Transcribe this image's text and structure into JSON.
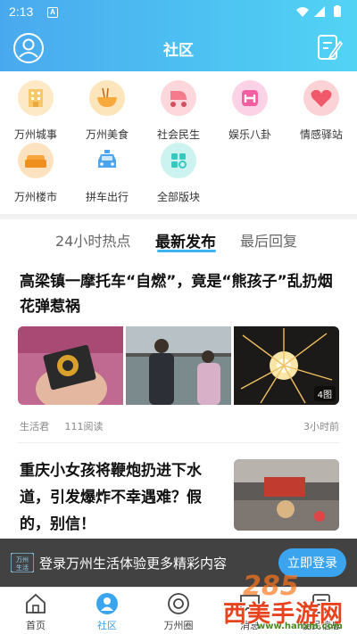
{
  "status_bar": {
    "time": "2:13",
    "notification": "A"
  },
  "header": {
    "title": "社区"
  },
  "categories": [
    {
      "label": "万州城事",
      "icon": "city-building-icon",
      "color": "#f6c86a"
    },
    {
      "label": "万州美食",
      "icon": "noodle-bowl-icon",
      "color": "#f8c14f"
    },
    {
      "label": "社会民生",
      "icon": "baby-stroller-icon",
      "color": "#f57a8c"
    },
    {
      "label": "娱乐八卦",
      "icon": "entertainment-icon",
      "color": "#f35ea2"
    },
    {
      "label": "情感驿站",
      "icon": "heart-icon",
      "color": "#f0596a"
    },
    {
      "label": "万州楼市",
      "icon": "sofa-icon",
      "color": "#f7a53a"
    },
    {
      "label": "拼车出行",
      "icon": "taxi-icon",
      "color": "#4aa4ee"
    },
    {
      "label": "全部版块",
      "icon": "all-sections-icon",
      "color": "#37c9c0"
    }
  ],
  "tabs": [
    {
      "label": "24小时热点",
      "active": false
    },
    {
      "label": "最新发布",
      "active": true
    },
    {
      "label": "最后回复",
      "active": false
    }
  ],
  "articles": [
    {
      "title": "高梁镇一摩托车“自燃”，竟是“熊孩子”乱扔烟花弹惹祸",
      "author": "生活君",
      "reads": "111阅读",
      "time": "3小时前",
      "image_count": "4图"
    },
    {
      "title": "重庆小女孩将鞭炮扔进下水道，引发爆炸不幸遇难？假的，别信！"
    }
  ],
  "login_banner": {
    "logo_text": "万州生活",
    "text": "登录万州生活体验更多精彩内容",
    "button": "立即登录"
  },
  "bottom_nav": [
    {
      "label": "首页",
      "icon": "home-icon",
      "active": false
    },
    {
      "label": "社区",
      "icon": "community-icon",
      "active": true
    },
    {
      "label": "万州圈",
      "icon": "circle-icon",
      "active": false
    },
    {
      "label": "消息",
      "icon": "message-icon",
      "active": false
    },
    {
      "label": "便民信息",
      "icon": "info-icon",
      "active": false
    }
  ],
  "watermark": {
    "brand": "西美手游网",
    "number": "285",
    "url": "www.hanxm.com"
  },
  "colors": {
    "accent": "#3aa4ef",
    "header_start": "#4aa9ee",
    "header_end": "#52d3f4"
  }
}
